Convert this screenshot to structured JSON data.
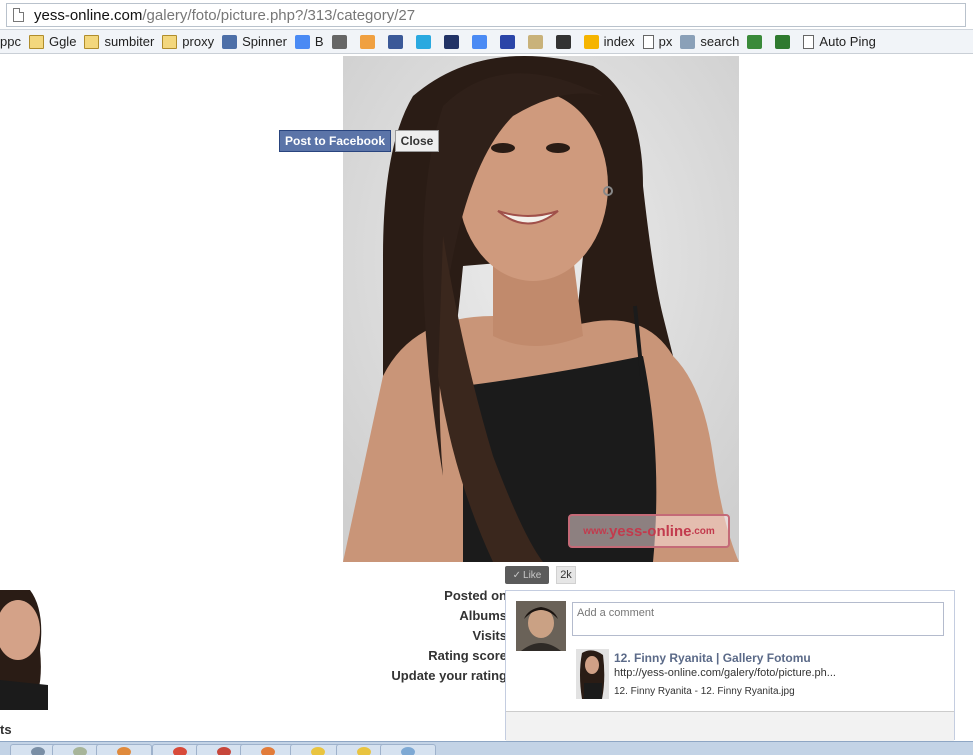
{
  "address_bar": {
    "host": "yess-online.com",
    "path": "/galery/foto/picture.php?/313/category/27"
  },
  "bookmarks": [
    {
      "label": "ppc",
      "icon": "folder-icon"
    },
    {
      "label": "Ggle",
      "icon": "folder-icon"
    },
    {
      "label": "sumbiter",
      "icon": "folder-icon"
    },
    {
      "label": "proxy",
      "icon": "folder-icon"
    },
    {
      "label": "Spinner",
      "icon": "spinner-icon"
    },
    {
      "label": "B",
      "icon": "google-b-icon"
    },
    {
      "label": "",
      "icon": "feather-icon"
    },
    {
      "label": "",
      "icon": "widget-icon"
    },
    {
      "label": "",
      "icon": "facebook-icon"
    },
    {
      "label": "",
      "icon": "twitter-icon"
    },
    {
      "label": "",
      "icon": "banner-icon"
    },
    {
      "label": "",
      "icon": "translate-icon"
    },
    {
      "label": "",
      "icon": "p-icon"
    },
    {
      "label": "",
      "icon": "person-icon"
    },
    {
      "label": "",
      "icon": "bike-icon"
    },
    {
      "label": "index",
      "icon": "flower-icon"
    },
    {
      "label": "px",
      "icon": "page-icon"
    },
    {
      "label": "search",
      "icon": "search-icon"
    },
    {
      "label": "",
      "icon": "graph-icon"
    },
    {
      "label": "",
      "icon": "globe-icon"
    },
    {
      "label": "Auto Ping",
      "icon": "page-icon"
    }
  ],
  "photo": {
    "watermark_prefix": "www.",
    "watermark_brand": "yess-online",
    "watermark_suffix": ".com"
  },
  "like": {
    "label": "Like",
    "count": "2k"
  },
  "info": {
    "posted_on": "Posted on",
    "albums": "Albums",
    "visits": "Visits",
    "rating_score": "Rating score",
    "update_rating": "Update your rating"
  },
  "left_partial_text": "ts",
  "fb_popup": {
    "comment_placeholder": "Add a comment",
    "title": "12. Finny Ryanita | Gallery Fotomu",
    "url": "http://yess-online.com/galery/foto/picture.ph...",
    "caption": "12. Finny Ryanita - 12. Finny Ryanita.jpg",
    "post_label": "Post to Facebook",
    "close_label": "Close"
  },
  "colors": {
    "fb_button": "#5b74a8",
    "watermark": "#c23a4d",
    "taskbar": "#c3d3e6"
  }
}
